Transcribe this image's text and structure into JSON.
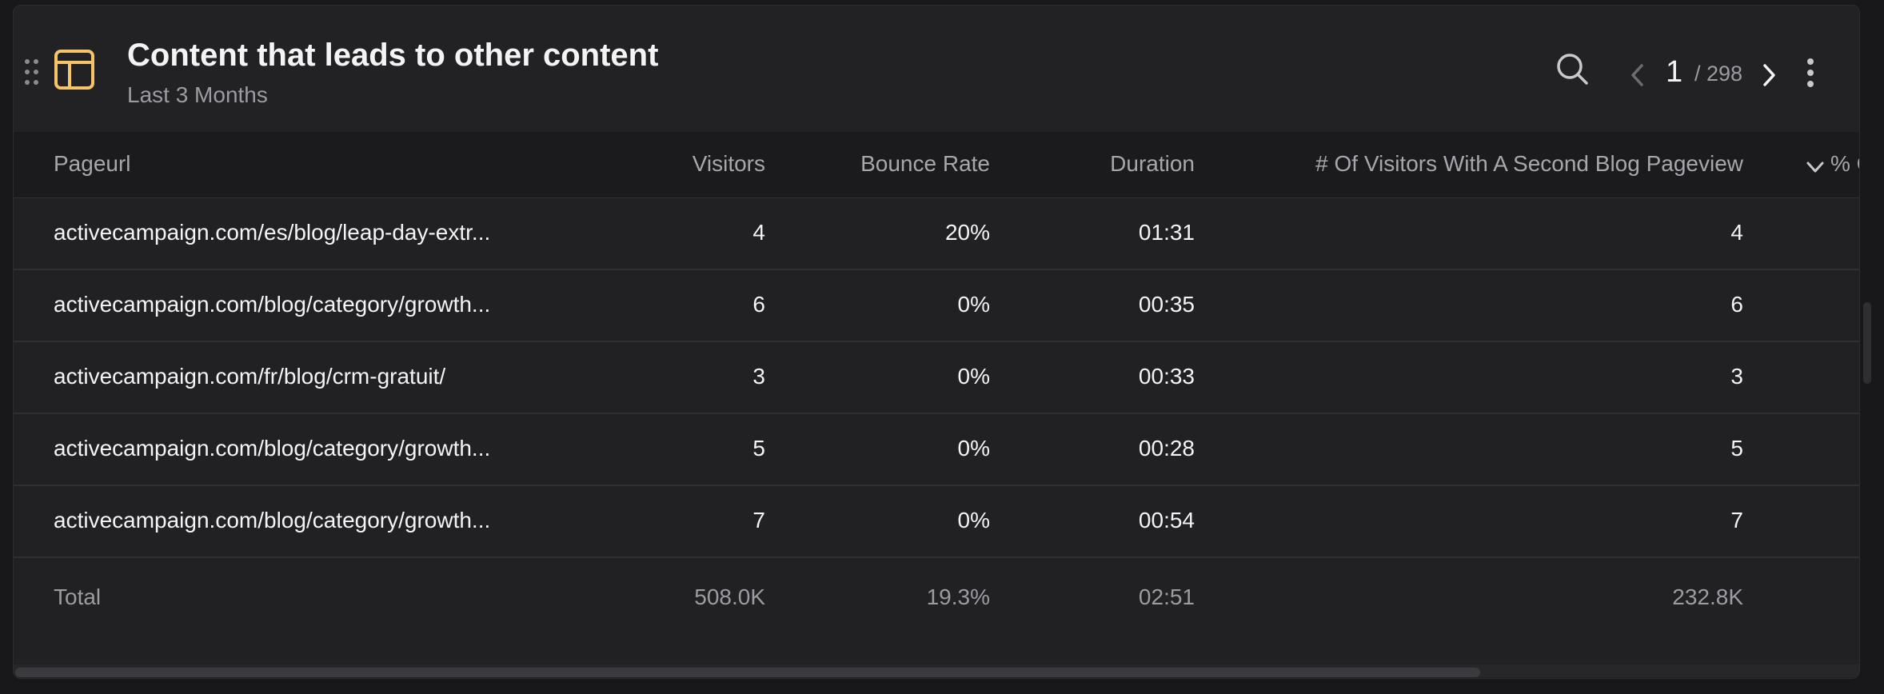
{
  "widget": {
    "title": "Content that leads to other content",
    "subtitle": "Last 3 Months",
    "icons": [
      "drag-handle-icon",
      "table-icon",
      "search-icon",
      "chevron-left-icon",
      "chevron-right-icon",
      "more-vertical-icon",
      "chevron-down-icon"
    ],
    "accent_color": "#f6c56b"
  },
  "pagination": {
    "current": "1",
    "total_label": "/ 298"
  },
  "table": {
    "columns": [
      "Pageurl",
      "Visitors",
      "Bounce Rate",
      "Duration",
      "# Of Visitors With A Second Blog Pageview",
      "% C"
    ],
    "rows": [
      [
        "activecampaign.com/es/blog/leap-day-extr...",
        "4",
        "20%",
        "01:31",
        "4"
      ],
      [
        "activecampaign.com/blog/category/growth...",
        "6",
        "0%",
        "00:35",
        "6"
      ],
      [
        "activecampaign.com/fr/blog/crm-gratuit/",
        "3",
        "0%",
        "00:33",
        "3"
      ],
      [
        "activecampaign.com/blog/category/growth...",
        "5",
        "0%",
        "00:28",
        "5"
      ],
      [
        "activecampaign.com/blog/category/growth...",
        "7",
        "0%",
        "00:54",
        "7"
      ]
    ],
    "total": [
      "Total",
      "508.0K",
      "19.3%",
      "02:51",
      "232.8K"
    ]
  }
}
